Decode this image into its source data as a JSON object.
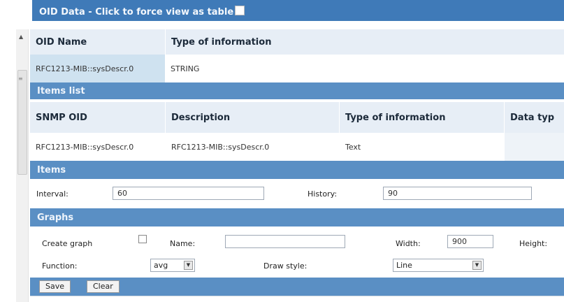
{
  "header": {
    "title": "OID Data - Click to force view as table"
  },
  "oid_table": {
    "columns": [
      "OID Name",
      "Type of information"
    ],
    "rows": [
      [
        "RFC1213-MIB::sysDescr.0",
        "STRING"
      ]
    ]
  },
  "items_list": {
    "title": "Items list",
    "columns": [
      "SNMP OID",
      "Description",
      "Type of information",
      "Data typ"
    ],
    "rows": [
      [
        "RFC1213-MIB::sysDescr.0",
        "RFC1213-MIB::sysDescr.0",
        "Text",
        ""
      ]
    ]
  },
  "items": {
    "title": "Items",
    "interval_label": "Interval:",
    "interval_value": "60",
    "history_label": "History:",
    "history_value": "90"
  },
  "graphs": {
    "title": "Graphs",
    "create_graph_label": "Create graph",
    "name_label": "Name:",
    "name_value": "",
    "width_label": "Width:",
    "width_value": "900",
    "height_label": "Height:",
    "function_label": "Function:",
    "function_value": "avg",
    "draw_style_label": "Draw style:",
    "draw_style_value": "Line"
  },
  "buttons": {
    "save": "Save",
    "clear": "Clear"
  },
  "colors": {
    "header_blue": "#3f7ab8",
    "section_blue": "#5a8fc4",
    "row_light": "#e7eef6"
  }
}
